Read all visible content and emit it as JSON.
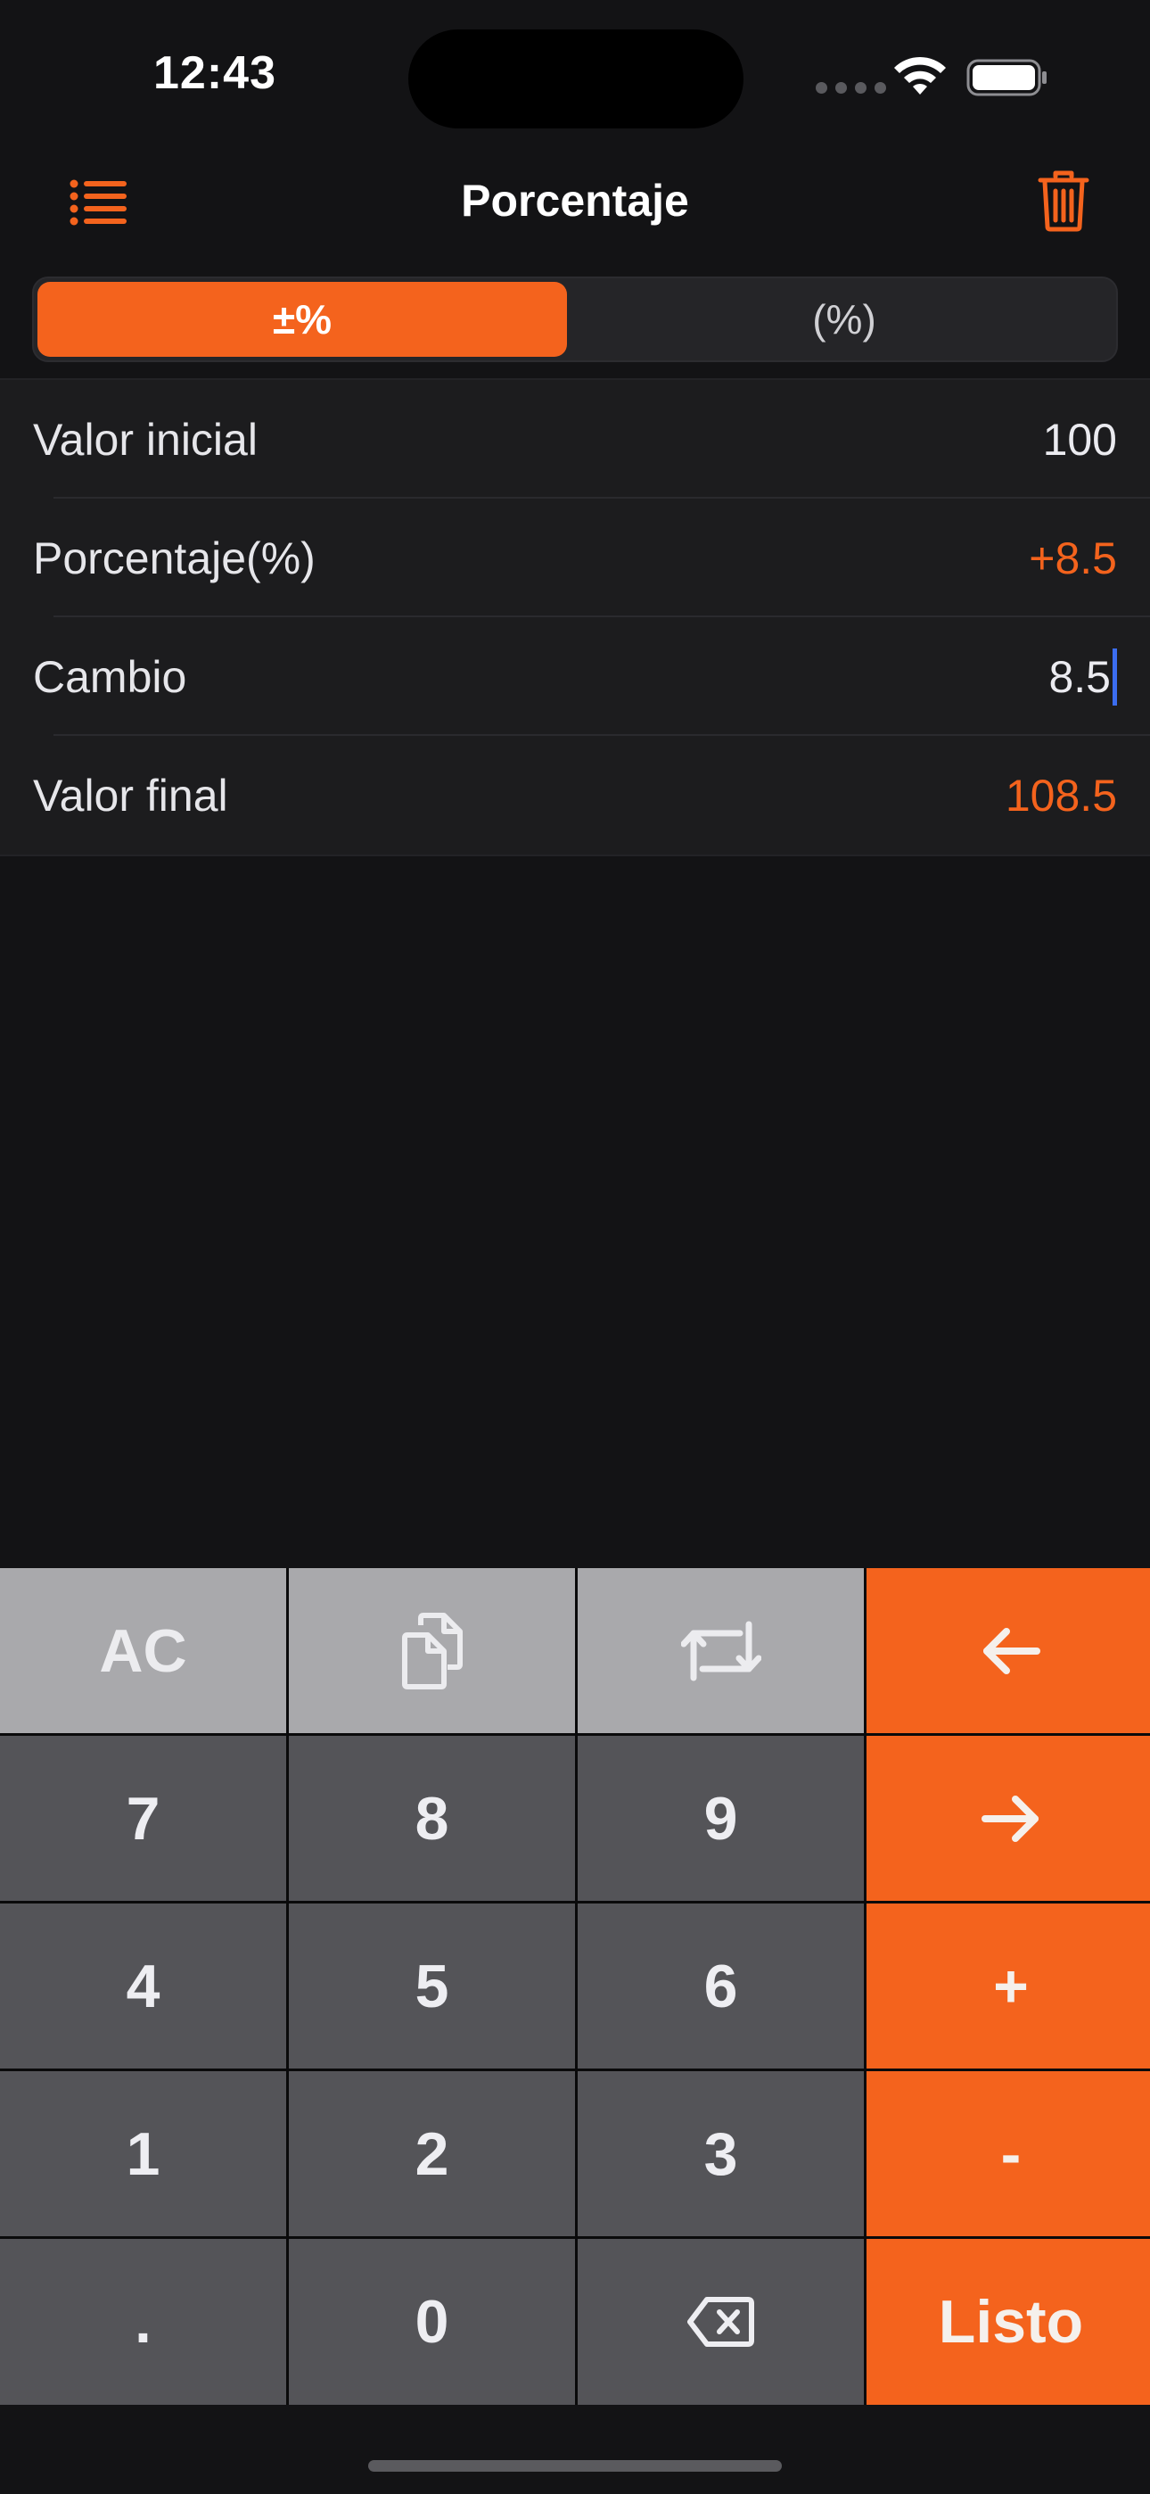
{
  "status_bar": {
    "time": "12:43"
  },
  "nav": {
    "title": "Porcentaje",
    "menu_icon": "list-icon",
    "trash_icon": "trash-icon"
  },
  "segments": {
    "active": "±%",
    "inactive": "(%)"
  },
  "fields": [
    {
      "label": "Valor inicial",
      "value": "100"
    },
    {
      "label": "Porcentaje(%)",
      "value": "+8.5"
    },
    {
      "label": "Cambio",
      "value": "8.5"
    },
    {
      "label": "Valor final",
      "value": "108.5"
    }
  ],
  "keypad": {
    "ac": "AC",
    "copy_icon": "copy-icon",
    "swap_icon": "swap-icon",
    "left_icon": "arrow-left-icon",
    "right_icon": "arrow-right-icon",
    "k7": "7",
    "k8": "8",
    "k9": "9",
    "k4": "4",
    "k5": "5",
    "k6": "6",
    "k1": "1",
    "k2": "2",
    "k3": "3",
    "plus": "+",
    "minus": "-",
    "dot": ".",
    "k0": "0",
    "backspace_icon": "backspace-icon",
    "done": "Listo"
  },
  "colors": {
    "accent": "#f4631d",
    "background": "#131315",
    "cell": "#1c1c1e",
    "key_dark": "#545458",
    "key_light": "#a9a9ac",
    "caret": "#3b6df0"
  }
}
